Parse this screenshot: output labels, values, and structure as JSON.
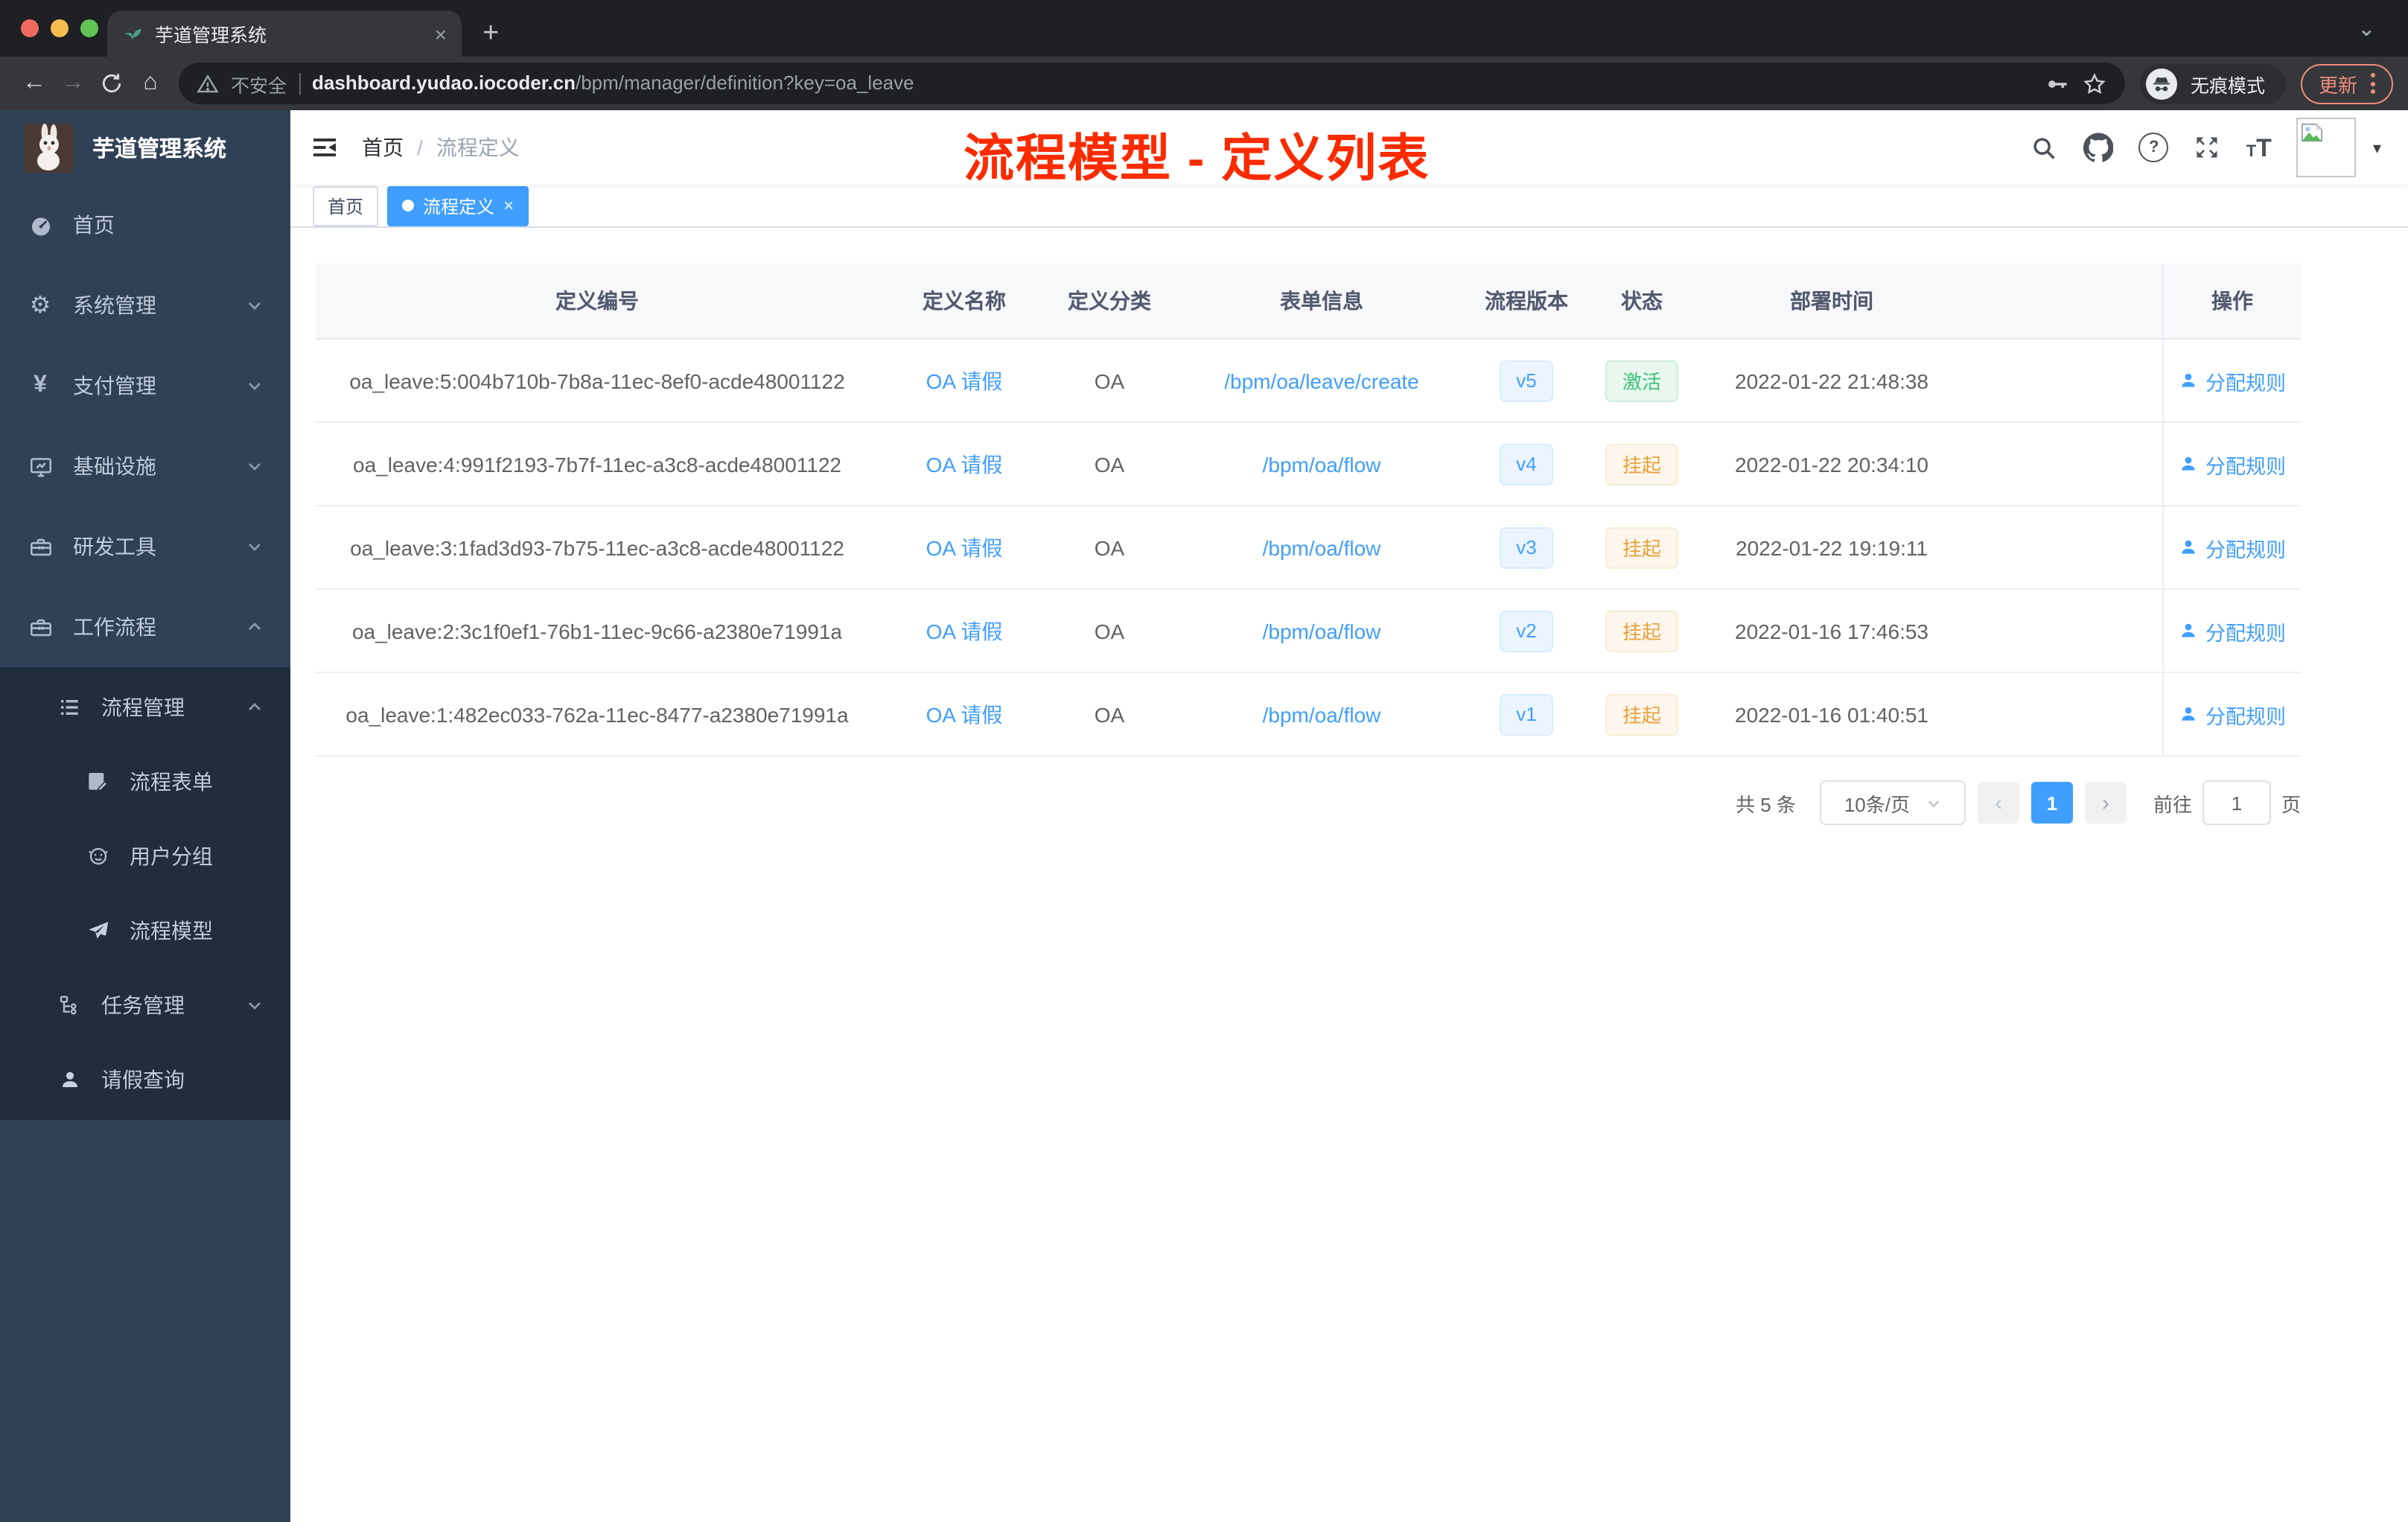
{
  "browser": {
    "tab": {
      "title": "芋道管理系统"
    },
    "toolbar": {
      "security_label": "不安全",
      "url_host": "dashboard.yudao.iocoder.cn",
      "url_path": "/bpm/manager/definition?key=oa_leave",
      "incognito_label": "无痕模式",
      "update_label": "更新"
    }
  },
  "glyphs": {
    "close": "×",
    "plus": "+",
    "back": "←",
    "forward": "→",
    "home": "⌂",
    "tab_search_caret": "⌄",
    "caret_down": "▾",
    "prev": "‹",
    "next": "›",
    "gear": "⚙",
    "yen": "¥",
    "question": "?",
    "t_small": "T",
    "t_big": "T"
  },
  "sidebar": {
    "brand": "芋道管理系统",
    "items": [
      {
        "label": "首页",
        "icon": "dashboard-icon"
      },
      {
        "label": "系统管理",
        "icon": "gear-icon",
        "arrow": "down"
      },
      {
        "label": "支付管理",
        "icon": "yen-icon",
        "arrow": "down"
      },
      {
        "label": "基础设施",
        "icon": "monitor-icon",
        "arrow": "down"
      },
      {
        "label": "研发工具",
        "icon": "toolbox-icon",
        "arrow": "down"
      },
      {
        "label": "工作流程",
        "icon": "toolbox-icon",
        "arrow": "up"
      }
    ],
    "submenu": [
      {
        "label": "流程管理",
        "icon": "list-icon",
        "arrow": "up"
      },
      {
        "label": "流程表单",
        "icon": "form-icon"
      },
      {
        "label": "用户分组",
        "icon": "robot-icon"
      },
      {
        "label": "流程模型",
        "icon": "paper-plane-icon"
      },
      {
        "label": "任务管理",
        "icon": "tree-icon",
        "arrow": "down"
      },
      {
        "label": "请假查询",
        "icon": "user-icon"
      }
    ]
  },
  "header": {
    "breadcrumb_home": "首页",
    "breadcrumb_sep": "/",
    "breadcrumb_current": "流程定义",
    "annotation": "流程模型 - 定义列表"
  },
  "tags": [
    {
      "label": "首页",
      "active": false
    },
    {
      "label": "流程定义",
      "active": true
    }
  ],
  "table": {
    "columns": [
      "定义编号",
      "定义名称",
      "定义分类",
      "表单信息",
      "流程版本",
      "状态",
      "部署时间",
      "操作"
    ],
    "rows": [
      {
        "id": "oa_leave:5:004b710b-7b8a-11ec-8ef0-acde48001122",
        "name": "OA 请假",
        "category": "OA",
        "form": "/bpm/oa/leave/create",
        "version": "v5",
        "status": "激活",
        "status_type": "success",
        "time": "2022-01-22 21:48:38",
        "action": "分配规则"
      },
      {
        "id": "oa_leave:4:991f2193-7b7f-11ec-a3c8-acde48001122",
        "name": "OA 请假",
        "category": "OA",
        "form": "/bpm/oa/flow",
        "version": "v4",
        "status": "挂起",
        "status_type": "warning",
        "time": "2022-01-22 20:34:10",
        "action": "分配规则"
      },
      {
        "id": "oa_leave:3:1fad3d93-7b75-11ec-a3c8-acde48001122",
        "name": "OA 请假",
        "category": "OA",
        "form": "/bpm/oa/flow",
        "version": "v3",
        "status": "挂起",
        "status_type": "warning",
        "time": "2022-01-22 19:19:11",
        "action": "分配规则"
      },
      {
        "id": "oa_leave:2:3c1f0ef1-76b1-11ec-9c66-a2380e71991a",
        "name": "OA 请假",
        "category": "OA",
        "form": "/bpm/oa/flow",
        "version": "v2",
        "status": "挂起",
        "status_type": "warning",
        "time": "2022-01-16 17:46:53",
        "action": "分配规则"
      },
      {
        "id": "oa_leave:1:482ec033-762a-11ec-8477-a2380e71991a",
        "name": "OA 请假",
        "category": "OA",
        "form": "/bpm/oa/flow",
        "version": "v1",
        "status": "挂起",
        "status_type": "warning",
        "time": "2022-01-16 01:40:51",
        "action": "分配规则"
      }
    ]
  },
  "pagination": {
    "total_label": "共 5 条",
    "page_size_label": "10条/页",
    "current_page": "1",
    "goto_label": "前往",
    "goto_value": "1",
    "page_unit_label": "页"
  },
  "colors": {
    "accent": "#409eff",
    "success": "#3ec27a",
    "warning": "#e6a23c",
    "annotation_red": "#fb2b00",
    "sidebar_bg": "#304156",
    "submenu_bg": "#1f2d3d"
  }
}
